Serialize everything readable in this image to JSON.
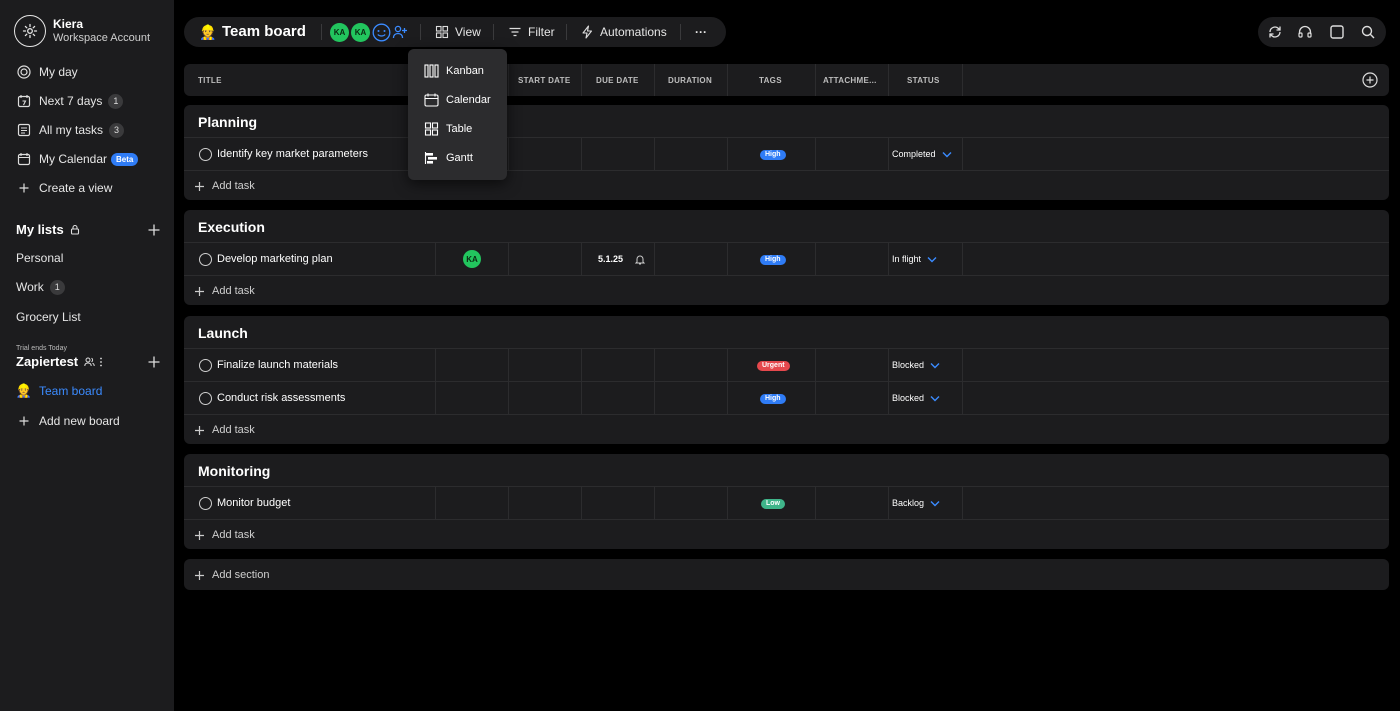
{
  "account": {
    "name": "Kiera",
    "subtitle": "Workspace Account"
  },
  "nav": [
    {
      "label": "My day",
      "icon": "target-icon"
    },
    {
      "label": "Next 7 days",
      "icon": "calendar-7-icon",
      "count": "1"
    },
    {
      "label": "All my tasks",
      "icon": "list-icon",
      "count": "3"
    },
    {
      "label": "My Calendar",
      "icon": "calendar-icon",
      "badge": "Beta"
    },
    {
      "label": "Create a view",
      "icon": "plus-icon"
    }
  ],
  "my_lists": {
    "title": "My lists",
    "items": [
      {
        "label": "Personal"
      },
      {
        "label": "Work",
        "count": "1"
      },
      {
        "label": "Grocery List"
      }
    ]
  },
  "workspace": {
    "trial": "Trial ends Today",
    "title": "Zapiertest",
    "boards": [
      {
        "label": "Team board",
        "emoji": "👷"
      }
    ],
    "add_board": "Add new board"
  },
  "toolbar": {
    "title": "Team board",
    "emoji": "👷",
    "avatars": [
      "KA",
      "KA"
    ],
    "view": "View",
    "filter": "Filter",
    "automations": "Automations",
    "more": "···"
  },
  "view_menu": [
    "Kanban",
    "Calendar",
    "Table",
    "Gantt"
  ],
  "columns": {
    "title": "TITLE",
    "start": "START DATE",
    "due": "DUE DATE",
    "duration": "DURATION",
    "tags": "TAGS",
    "attach": "ATTACHME...",
    "status": "STATUS"
  },
  "sections": [
    {
      "title": "Planning",
      "tasks": [
        {
          "name": "Identify key market parameters",
          "tag": "High",
          "status": "Completed"
        }
      ]
    },
    {
      "title": "Execution",
      "tasks": [
        {
          "name": "Develop marketing plan",
          "assignee": "KA",
          "due": "5.1.25",
          "tag": "High",
          "status": "In flight"
        }
      ]
    },
    {
      "title": "Launch",
      "tasks": [
        {
          "name": "Finalize launch materials",
          "tag": "Urgent",
          "status": "Blocked"
        },
        {
          "name": "Conduct risk assessments",
          "tag": "High",
          "status": "Blocked"
        }
      ]
    },
    {
      "title": "Monitoring",
      "tasks": [
        {
          "name": "Monitor budget",
          "tag": "Low",
          "status": "Backlog"
        }
      ]
    }
  ],
  "add_task": "Add task",
  "add_section": "Add section",
  "colors": {
    "accent": "#2f7cf6",
    "high": "#2f7cf6",
    "urgent": "#e5484d",
    "low": "#3fb58a",
    "avatar": "#22c55e"
  }
}
